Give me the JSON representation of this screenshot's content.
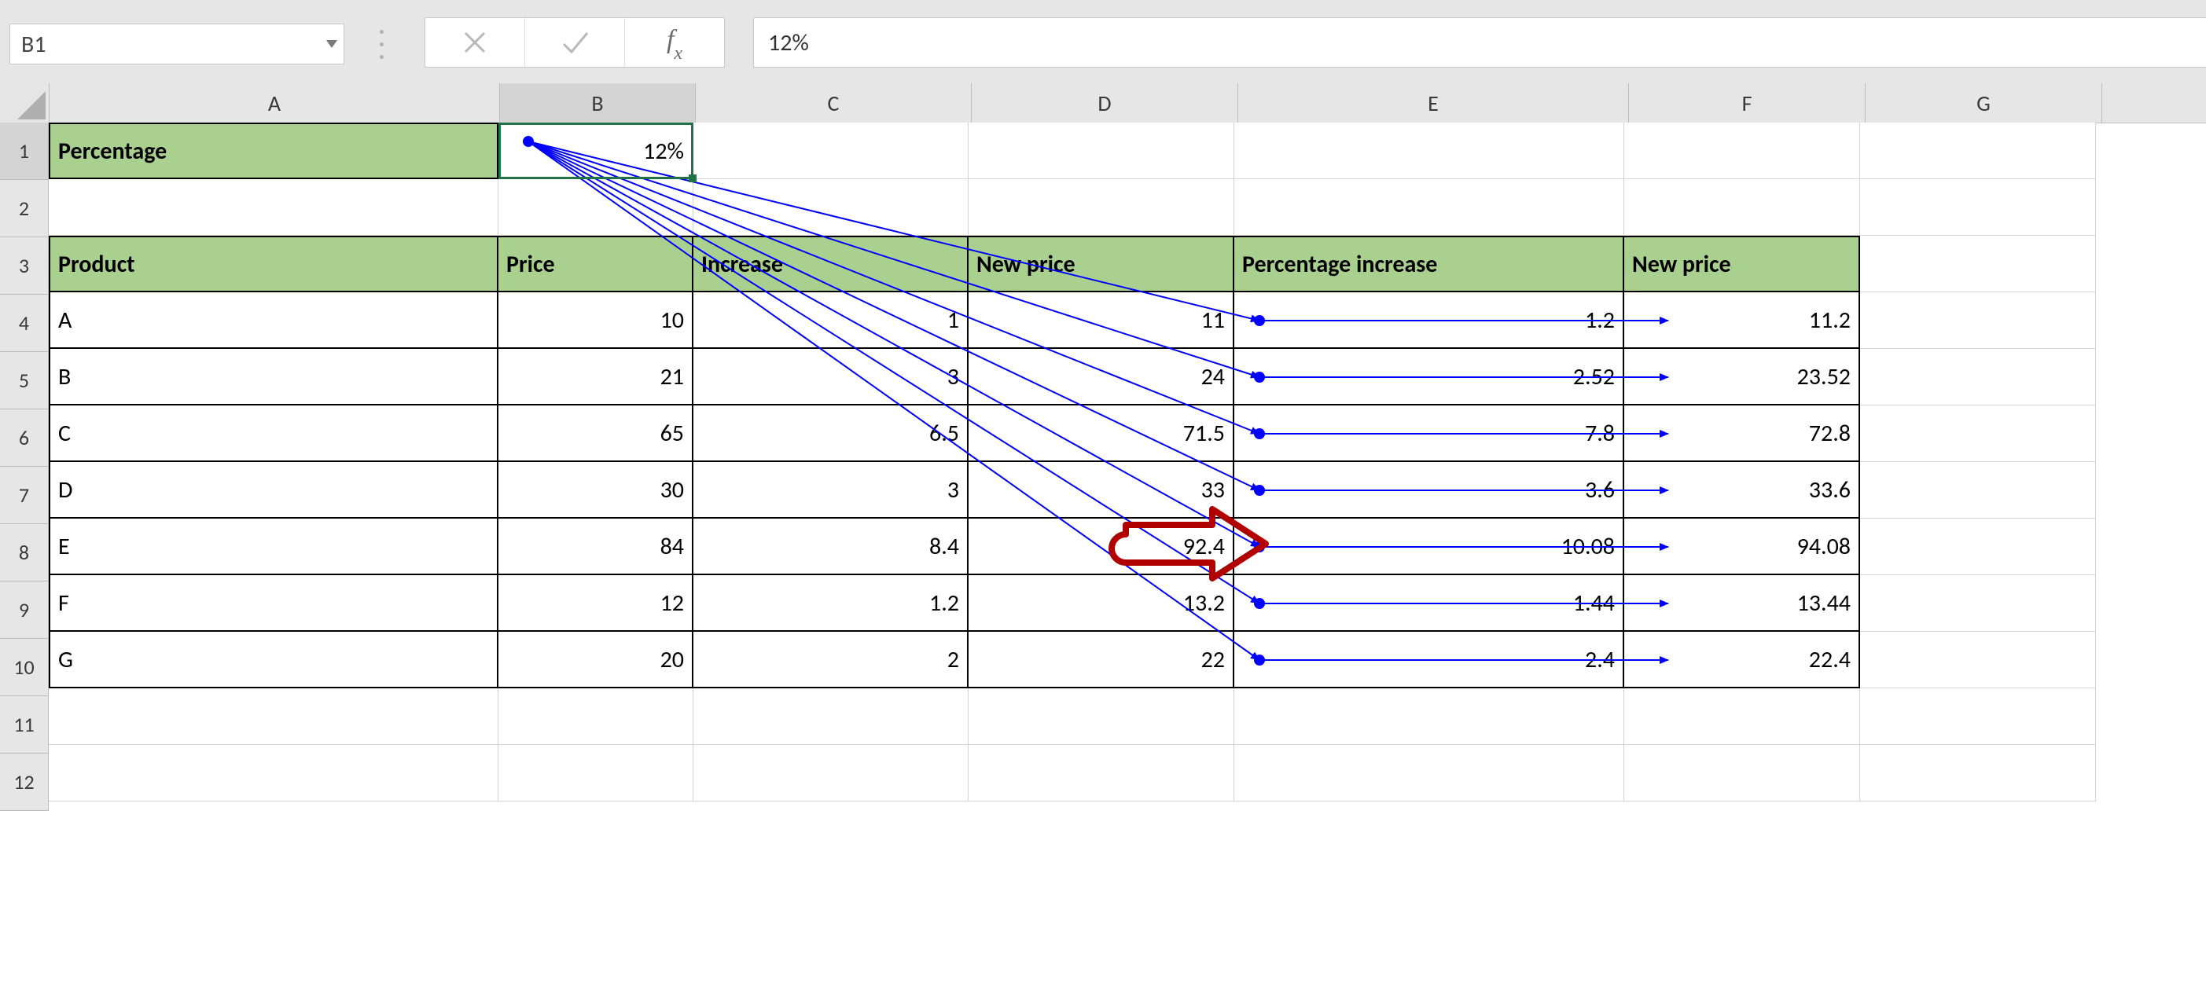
{
  "name_box_value": "B1",
  "formula_bar_value": "12%",
  "columns": [
    "A",
    "B",
    "C",
    "D",
    "E",
    "F",
    "G"
  ],
  "row_numbers": [
    "1",
    "2",
    "3",
    "4",
    "5",
    "6",
    "7",
    "8",
    "9",
    "10",
    "11",
    "12"
  ],
  "row1": {
    "A": "Percentage",
    "B": "12%"
  },
  "headers": {
    "A": "Product",
    "B": "Price",
    "C": "Increase",
    "D": "New price",
    "E": "Percentage increase",
    "F": "New price"
  },
  "table": [
    {
      "product": "A",
      "price": "10",
      "increase": "1",
      "newprice": "11",
      "pct_increase": "1.2",
      "newprice2": "11.2"
    },
    {
      "product": "B",
      "price": "21",
      "increase": "3",
      "newprice": "24",
      "pct_increase": "2.52",
      "newprice2": "23.52"
    },
    {
      "product": "C",
      "price": "65",
      "increase": "6.5",
      "newprice": "71.5",
      "pct_increase": "7.8",
      "newprice2": "72.8"
    },
    {
      "product": "D",
      "price": "30",
      "increase": "3",
      "newprice": "33",
      "pct_increase": "3.6",
      "newprice2": "33.6"
    },
    {
      "product": "E",
      "price": "84",
      "increase": "8.4",
      "newprice": "92.4",
      "pct_increase": "10.08",
      "newprice2": "94.08"
    },
    {
      "product": "F",
      "price": "12",
      "increase": "1.2",
      "newprice": "13.2",
      "pct_increase": "1.44",
      "newprice2": "13.44"
    },
    {
      "product": "G",
      "price": "20",
      "increase": "2",
      "newprice": "22",
      "pct_increase": "2.4",
      "newprice2": "22.4"
    }
  ]
}
